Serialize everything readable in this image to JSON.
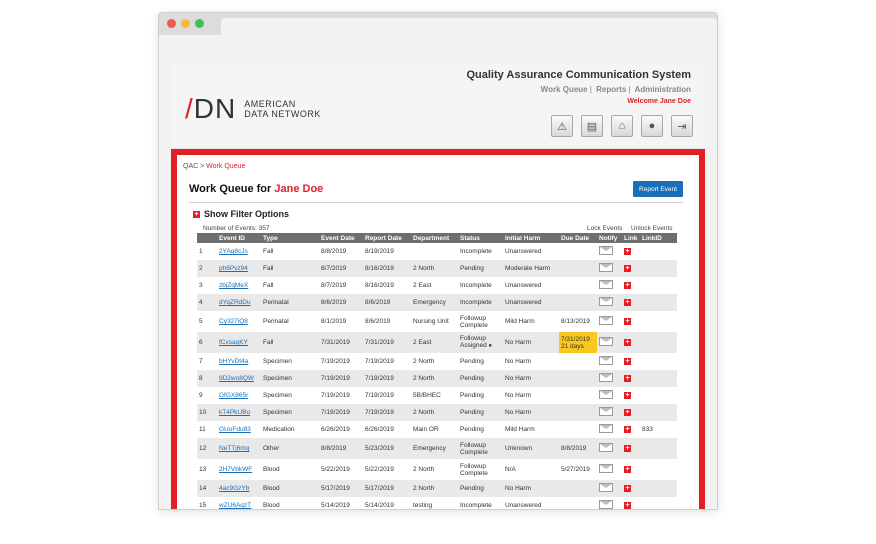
{
  "app": {
    "title": "Quality Assurance Communication System",
    "nav": [
      "Work Queue",
      "Reports",
      "Administration"
    ],
    "welcome": "Welcome Jane Doe",
    "logo_mark": "ADN",
    "logo_line1": "AMERICAN",
    "logo_line2": "DATA NETWORK"
  },
  "breadcrumb": {
    "root": "QAC",
    "sep": ">",
    "current": "Work Queue"
  },
  "heading": {
    "prefix": "Work Queue for",
    "user": "Jane Doe"
  },
  "report_button": "Report Event",
  "filter_label": "Show Filter Options",
  "count_label": "Number of Events: 357",
  "lock_label": "Lock Events",
  "unlock_label": "Unlock Events",
  "table": {
    "headers": [
      "",
      "Event ID",
      "Type",
      "Event Date",
      "Report Date",
      "Department",
      "Status",
      "Initial Harm",
      "Due Date",
      "Notify",
      "Link",
      "LinkID"
    ],
    "rows": [
      {
        "n": "1",
        "id": "2YAq8cJs",
        "type": "Fall",
        "event": "8/8/2019",
        "report": "8/19/2019",
        "dept": "",
        "status": "Incomplete",
        "harm": "Unanswered",
        "due": "",
        "linkid": ""
      },
      {
        "n": "2",
        "id": "ph6Pvz94",
        "type": "Fall",
        "event": "8/7/2019",
        "report": "8/16/2019",
        "dept": "2 North",
        "status": "Pending",
        "harm": "Moderate Harm",
        "due": "",
        "linkid": ""
      },
      {
        "n": "3",
        "id": "zbjZqMeX",
        "type": "Fall",
        "event": "8/7/2019",
        "report": "8/16/2019",
        "dept": "2 East",
        "status": "Incomplete",
        "harm": "Unanswered",
        "due": "",
        "linkid": ""
      },
      {
        "n": "4",
        "id": "dYqZRdDu",
        "type": "Perinatal",
        "event": "8/6/2019",
        "report": "8/6/2019",
        "dept": "Emergency",
        "status": "Incomplete",
        "harm": "Unanswered",
        "due": "",
        "linkid": ""
      },
      {
        "n": "5",
        "id": "Cy327iQ8",
        "type": "Perinatal",
        "event": "8/1/2019",
        "report": "8/6/2019",
        "dept": "Nursing Unit",
        "status": "Followup Complete",
        "harm": "Mild Harm",
        "due": "8/13/2019",
        "linkid": ""
      },
      {
        "n": "6",
        "id": "fCxsaqKY",
        "type": "Fall",
        "event": "7/31/2019",
        "report": "7/31/2019",
        "dept": "2 East",
        "status": "Followup Assigned",
        "harm": "No Harm",
        "due": "7/31/2019 21 days",
        "linkid": ""
      },
      {
        "n": "7",
        "id": "bHYvDt4a",
        "type": "Specimen",
        "event": "7/19/2019",
        "report": "7/19/2019",
        "dept": "2 North",
        "status": "Pending",
        "harm": "No Harm",
        "due": "",
        "linkid": ""
      },
      {
        "n": "8",
        "id": "9D2wo8QW",
        "type": "Specimen",
        "event": "7/19/2019",
        "report": "7/19/2019",
        "dept": "2 North",
        "status": "Pending",
        "harm": "No Harm",
        "due": "",
        "linkid": ""
      },
      {
        "n": "9",
        "id": "GfGX865r",
        "type": "Specimen",
        "event": "7/19/2019",
        "report": "7/19/2019",
        "dept": "5B/BHEC",
        "status": "Pending",
        "harm": "No Harm",
        "due": "",
        "linkid": ""
      },
      {
        "n": "10",
        "id": "kT4PkUBo",
        "type": "Specimen",
        "event": "7/19/2019",
        "report": "7/19/2019",
        "dept": "2 North",
        "status": "Pending",
        "harm": "No Harm",
        "due": "",
        "linkid": ""
      },
      {
        "n": "11",
        "id": "GUoFdu83",
        "type": "Medication",
        "event": "6/26/2019",
        "report": "6/26/2019",
        "dept": "Main OR",
        "status": "Pending",
        "harm": "Mild Harm",
        "due": "",
        "linkid": "833"
      },
      {
        "n": "12",
        "id": "NeTTj6mq",
        "type": "Other",
        "event": "8/8/2019",
        "report": "5/23/2019",
        "dept": "Emergency",
        "status": "Followup Complete",
        "harm": "Unknown",
        "due": "8/8/2019",
        "linkid": ""
      },
      {
        "n": "13",
        "id": "2H7VbkWF",
        "type": "Blood",
        "event": "5/22/2019",
        "report": "5/22/2019",
        "dept": "2 North",
        "status": "Followup Complete",
        "harm": "N/A",
        "due": "5/27/2019",
        "linkid": ""
      },
      {
        "n": "14",
        "id": "4ac9GzYb",
        "type": "Blood",
        "event": "5/17/2019",
        "report": "5/17/2019",
        "dept": "2 North",
        "status": "Pending",
        "harm": "No Harm",
        "due": "",
        "linkid": ""
      },
      {
        "n": "15",
        "id": "wZU6AqzT",
        "type": "Blood",
        "event": "5/14/2019",
        "report": "5/14/2019",
        "dept": "testing",
        "status": "Incomplete",
        "harm": "Unanswered",
        "due": "",
        "linkid": ""
      }
    ]
  },
  "icons": [
    "alert-icon",
    "document-icon",
    "home-icon",
    "user-icon",
    "logout-icon"
  ],
  "colors": {
    "accent": "#e31e24",
    "link": "#1a6fb8",
    "highlight": "#f7c81e"
  }
}
